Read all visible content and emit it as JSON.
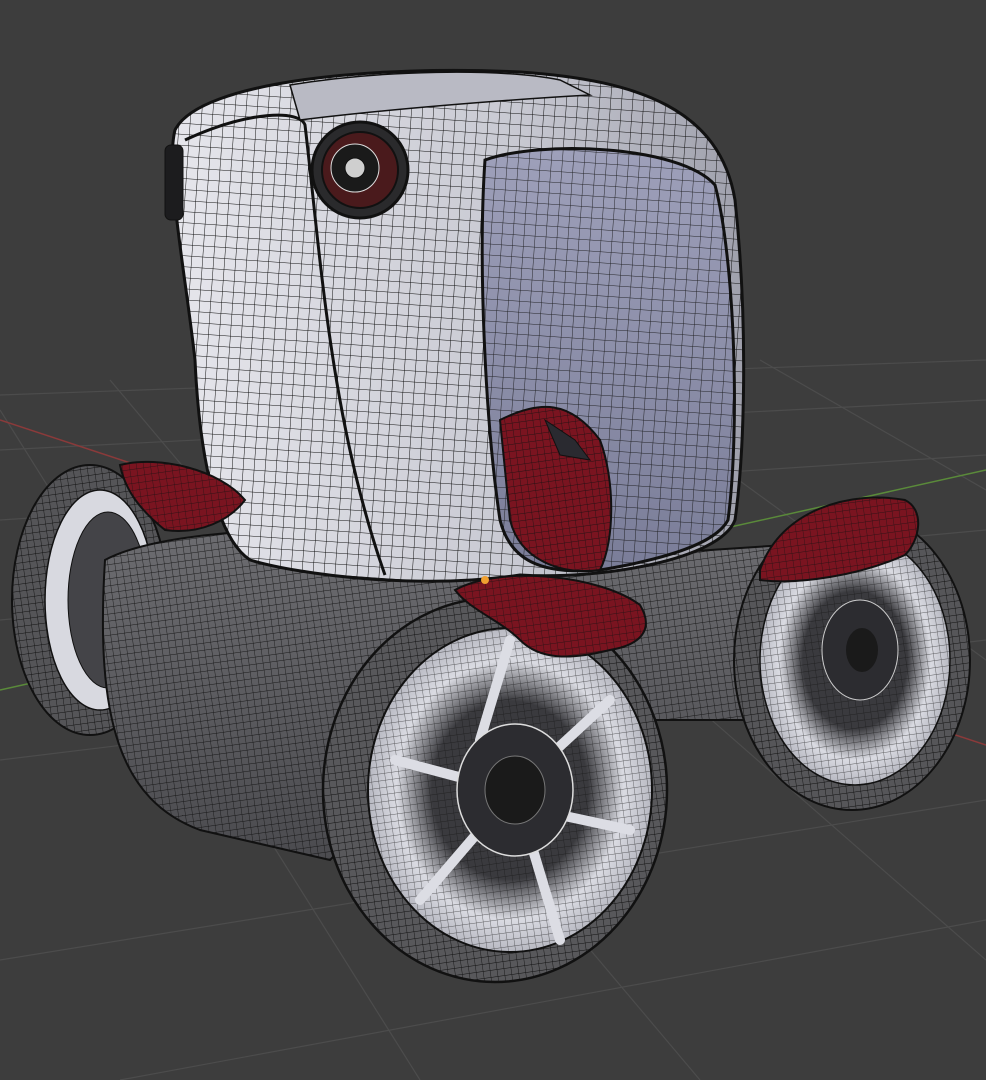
{
  "viewport": {
    "mode": "3d-viewport",
    "shading": "solid-with-wireframe-overlay",
    "object": "wheeled-pod-vehicle-model"
  },
  "colors": {
    "background": "#3d3d3d",
    "grid": "#4a4a4a",
    "x_axis": "#8a3a3a",
    "y_axis": "#5a8a3a",
    "body": "#cfd0d8",
    "window": "#8b8ea8",
    "accent": "#7a1420",
    "tire": "#5a5a5a",
    "wire": "#111111",
    "origin": "#f0a030"
  },
  "icons": {
    "origin": "origin-point-icon"
  }
}
